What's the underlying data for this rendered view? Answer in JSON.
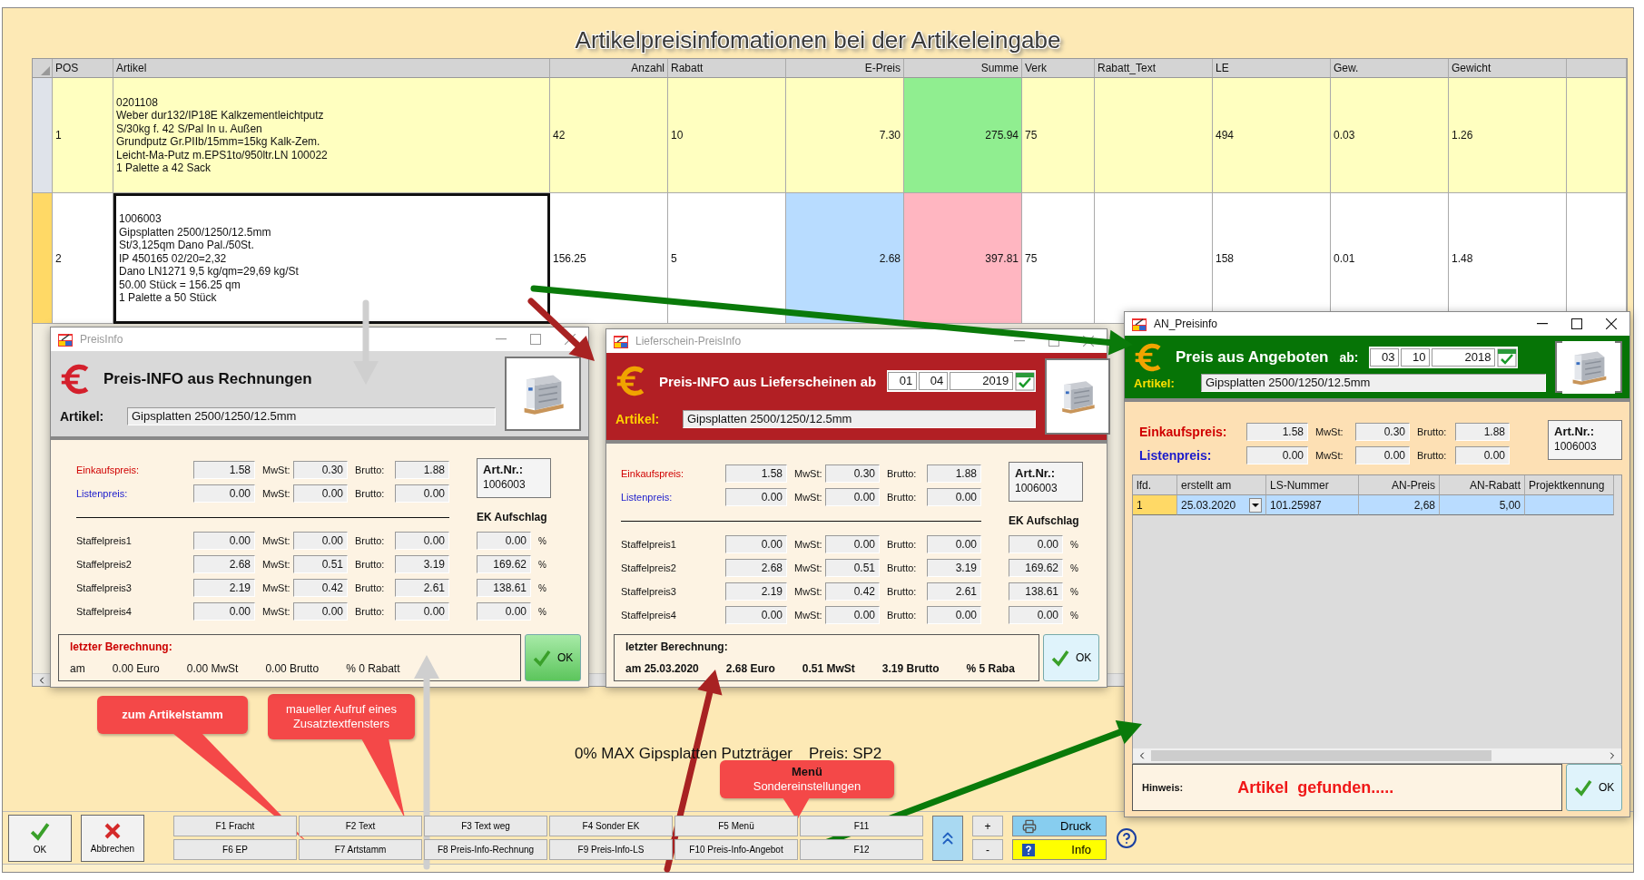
{
  "title": "Artikelpreisinfomationen bei der Artikeleingabe",
  "table": {
    "columns": [
      "POS",
      "Artikel",
      "Anzahl",
      "Rabatt",
      "E-Preis",
      "Summe",
      "Verk",
      "Rabatt_Text",
      "LE",
      "Gew.",
      "Gewicht"
    ],
    "rows": [
      {
        "selected": false,
        "color": "#ffffc0",
        "cells": [
          {
            "text": "1"
          },
          {
            "focused": false,
            "lines": [
              "0201108",
              "Weber dur132/IP18E Kalkzementleichtputz",
              "S/30kg f. 42 S/Pal In u. Außen",
              "Grundputz Gr.PIIb/15mm=15kg Kalk-Zem.",
              "Leicht-Ma-Putz m.EPS1to/950ltr.LN 100022",
              "1 Palette a 42 Sack"
            ]
          },
          {
            "text": "42"
          },
          {
            "text": "10"
          },
          {
            "text": "7.30"
          },
          {
            "text": "275.94",
            "color": "#90ee90"
          },
          {
            "text": "75"
          },
          null,
          {
            "text": "494"
          },
          {
            "text": "0.03"
          },
          {
            "text": "1.26"
          }
        ]
      },
      {
        "selected": true,
        "color": "#ffffff",
        "cells": [
          {
            "text": "2"
          },
          {
            "focused": true,
            "lines": [
              "1006003",
              "Gipsplatten 2500/1250/12.5mm",
              "St/3,125qm Dano Pal./50St.",
              "IP 450165 02/20=2,32",
              "Dano LN1271 9,5 kg/qm=29,69 kg/St",
              "50.00 Stück = 156.25 qm",
              "1 Palette a 50 Stück"
            ]
          },
          {
            "text": "156.25"
          },
          {
            "text": "5"
          },
          {
            "text": "2.68",
            "color": "#b8dcff"
          },
          {
            "text": "397.81",
            "color": "#ffb6c1"
          },
          {
            "text": "75"
          },
          null,
          {
            "text": "158"
          },
          {
            "text": "0.01"
          },
          {
            "text": "1.48"
          }
        ]
      }
    ]
  },
  "windows": [
    {
      "kind": "invoice",
      "active": false,
      "title": "PreisInfo",
      "heading": "Preis-INFO aus Rechnungen",
      "article_label": "Artikel:",
      "article": "Gipsplatten 2500/1250/12.5mm",
      "art_nr_label": "Art.Nr.:",
      "art_nr": "1006003",
      "prices": [
        {
          "kind": "purchase",
          "label": "Einkaufspreis:",
          "net": "1.58",
          "vat_label": "MwSt:",
          "vat": "0.30",
          "gross_label": "Brutto:",
          "gross": "1.88"
        },
        {
          "kind": "list",
          "label": "Listenpreis:",
          "net": "0.00",
          "vat_label": "MwSt:",
          "vat": "0.00",
          "gross_label": "Brutto:",
          "gross": "0.00"
        }
      ],
      "markup_label": "EK Aufschlag",
      "tiers": [
        {
          "label": "Staffelpreis1",
          "net": "0.00",
          "vat_label": "MwSt:",
          "vat": "0.00",
          "gross_label": "Brutto:",
          "gross": "0.00",
          "markup": "0.00",
          "unit": "%"
        },
        {
          "label": "Staffelpreis2",
          "net": "2.68",
          "vat_label": "MwSt:",
          "vat": "0.51",
          "gross_label": "Brutto:",
          "gross": "3.19",
          "markup": "169.62",
          "unit": "%"
        },
        {
          "label": "Staffelpreis3",
          "net": "2.19",
          "vat_label": "MwSt:",
          "vat": "0.42",
          "gross_label": "Brutto:",
          "gross": "2.61",
          "markup": "138.61",
          "unit": "%"
        },
        {
          "label": "Staffelpreis4",
          "net": "0.00",
          "vat_label": "MwSt:",
          "vat": "0.00",
          "gross_label": "Brutto:",
          "gross": "0.00",
          "markup": "0.00",
          "unit": "%"
        }
      ],
      "last": {
        "title": "letzter Berechnung:",
        "items": [
          "am",
          "0.00 Euro",
          "0.00 MwSt",
          "0.00 Brutto",
          "% 0 Rabatt"
        ]
      },
      "ok": "OK"
    },
    {
      "kind": "delivery",
      "active": false,
      "title": "Lieferschein-PreisInfo",
      "heading": "Preis-INFO aus Lieferscheinen ab",
      "date": [
        "01",
        "04",
        "2019"
      ],
      "article_label": "Artikel:",
      "article": "Gipsplatten 2500/1250/12.5mm",
      "art_nr_label": "Art.Nr.:",
      "art_nr": "1006003",
      "prices": [
        {
          "kind": "purchase",
          "label": "Einkaufspreis:",
          "net": "1.58",
          "vat_label": "MwSt:",
          "vat": "0.30",
          "gross_label": "Brutto:",
          "gross": "1.88"
        },
        {
          "kind": "list",
          "label": "Listenpreis:",
          "net": "0.00",
          "vat_label": "MwSt:",
          "vat": "0.00",
          "gross_label": "Brutto:",
          "gross": "0.00"
        }
      ],
      "markup_label": "EK Aufschlag",
      "tiers": [
        {
          "label": "Staffelpreis1",
          "net": "0.00",
          "vat_label": "MwSt:",
          "vat": "0.00",
          "gross_label": "Brutto:",
          "gross": "0.00",
          "markup": "0.00",
          "unit": "%"
        },
        {
          "label": "Staffelpreis2",
          "net": "2.68",
          "vat_label": "MwSt:",
          "vat": "0.51",
          "gross_label": "Brutto:",
          "gross": "3.19",
          "markup": "169.62",
          "unit": "%"
        },
        {
          "label": "Staffelpreis3",
          "net": "2.19",
          "vat_label": "MwSt:",
          "vat": "0.42",
          "gross_label": "Brutto:",
          "gross": "2.61",
          "markup": "138.61",
          "unit": "%"
        },
        {
          "label": "Staffelpreis4",
          "net": "0.00",
          "vat_label": "MwSt:",
          "vat": "0.00",
          "gross_label": "Brutto:",
          "gross": "0.00",
          "markup": "0.00",
          "unit": "%"
        }
      ],
      "last": {
        "title": "letzter Berechnung:",
        "items": [
          "am 25.03.2020",
          "2.68 Euro",
          "0.51 MwSt",
          "3.19 Brutto",
          "% 5 Raba"
        ]
      },
      "ok": "OK"
    },
    {
      "kind": "offer",
      "active": true,
      "title": "AN_Preisinfo",
      "heading": "Preis aus Angeboten",
      "date_label": "ab:",
      "date": [
        "03",
        "10",
        "2018"
      ],
      "article_label": "Artikel:",
      "article": "Gipsplatten 2500/1250/12.5mm",
      "art_nr_label": "Art.Nr.:",
      "art_nr": "1006003",
      "prices": [
        {
          "kind": "purchase",
          "label": "Einkaufspreis:",
          "net": "1.58",
          "vat_label": "MwSt:",
          "vat": "0.30",
          "gross_label": "Brutto:",
          "gross": "1.88"
        },
        {
          "kind": "list",
          "label": "Listenpreis:",
          "net": "0.00",
          "vat_label": "MwSt:",
          "vat": "0.00",
          "gross_label": "Brutto:",
          "gross": "0.00"
        }
      ],
      "grid": {
        "columns": [
          "lfd.",
          "erstellt am",
          "LS-Nummer",
          "AN-Preis",
          "AN-Rabatt",
          "Projektkennung"
        ],
        "rows": [
          {
            "selected": true,
            "cells": [
              "1",
              "25.03.2020",
              "101.25987",
              "2,68",
              "5,00"
            ]
          }
        ]
      },
      "hint": {
        "label": "Hinweis:",
        "text": "Artikel  gefunden....."
      },
      "ok": "OK"
    }
  ],
  "info": {
    "product": "0% MAX Gipsplatten Putzträger",
    "price": "Preis: SP2"
  },
  "callouts": [
    {
      "title": "zum Artikelstamm"
    },
    {
      "text": "maueller Aufruf eines Zusatztextfensters"
    },
    {
      "title": "Menü",
      "text": "Sondereinstellungen"
    }
  ],
  "toolbar": {
    "ok": "OK",
    "cancel": "Abbrechen",
    "fkeys": [
      "F1 Fracht",
      "F2 Text",
      "F3 Text weg",
      "F4 Sonder EK",
      "F5 Menü",
      "F11",
      "F6 EP",
      "F7 Artstamm",
      "F8 Preis-Info-Rechnung",
      "F9 Preis-Info-LS",
      "F10 Preis-Info-Angebot",
      "F12"
    ],
    "plus": "+",
    "minus": "-",
    "print": "Druck",
    "info": "Info"
  }
}
